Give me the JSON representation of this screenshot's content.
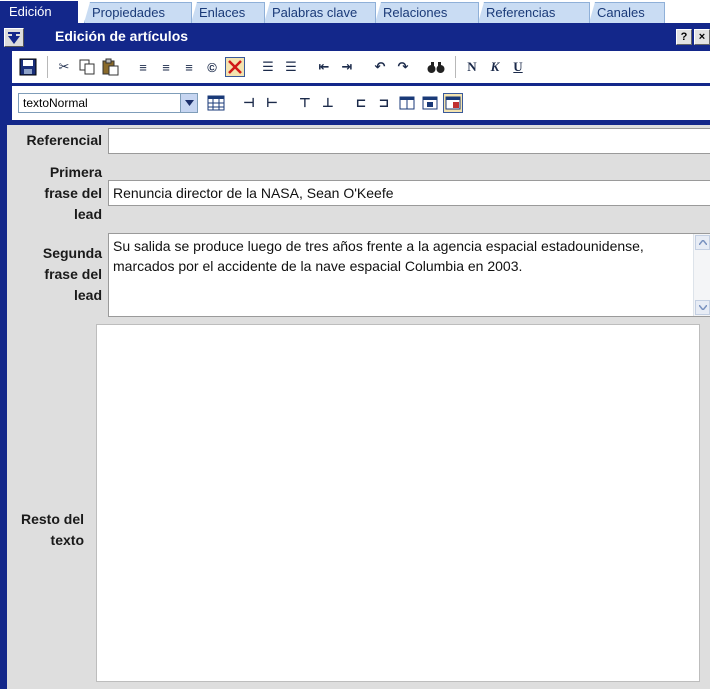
{
  "tabs": [
    {
      "label": "Edición",
      "active": true
    },
    {
      "label": "Propiedades"
    },
    {
      "label": "Enlaces"
    },
    {
      "label": "Palabras clave"
    },
    {
      "label": "Relaciones"
    },
    {
      "label": "Referencias"
    },
    {
      "label": "Canales"
    }
  ],
  "panel": {
    "title": "Edición de artículos",
    "help_label": "?",
    "close_label": "×"
  },
  "toolbar": {
    "style_select_value": "textoNormal",
    "bold_label": "N",
    "italic_label": "K",
    "underline_label": "U"
  },
  "fields": {
    "referencial": {
      "label": "Referencial",
      "value": ""
    },
    "primera_frase": {
      "label_lines": [
        "Primera",
        "frase del",
        "lead"
      ],
      "value": "Renuncia director de la NASA, Sean O'Keefe"
    },
    "segunda_frase": {
      "label_lines": [
        "Segunda",
        "frase del",
        "lead"
      ],
      "value": "Su salida se produce luego de tres años frente a la agencia espacial estadounidense, marcados por el accidente de la nave espacial Columbia en 2003."
    },
    "resto_texto": {
      "label_lines": [
        "Resto del",
        "texto"
      ],
      "value": ""
    }
  },
  "colors": {
    "frame": "#13278a",
    "tab_inactive": "#c9dcf3",
    "content_bg": "#dedede"
  }
}
